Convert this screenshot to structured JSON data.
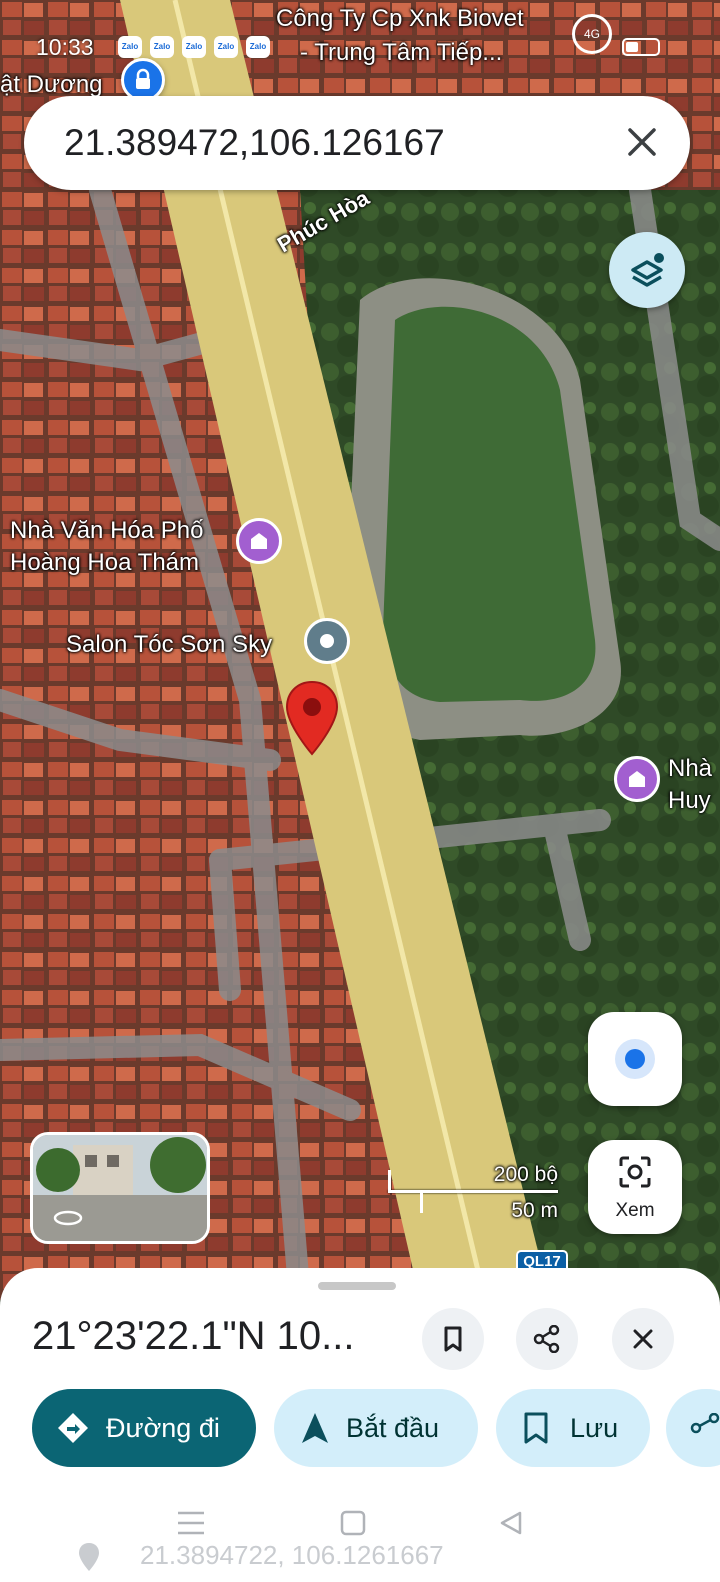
{
  "status_bar": {
    "time": "10:33",
    "zalo_label": "Zalo",
    "network": "4G"
  },
  "search": {
    "value": "21.389472,106.126167"
  },
  "map_labels": {
    "company": "Công Ty Cp Xnk Biovet",
    "company_line2": "- Trung Tâm Tiếp...",
    "street_top_left": "ật Dương",
    "road": "Phúc Hòa",
    "culture_house_line1": "Nhà Văn Hóa Phố",
    "culture_house_line2": "Hoàng Hoa Thám",
    "salon": "Salon Tóc Sơn Sky",
    "right_poi_line1": "Nhà",
    "right_poi_line2": "Huy",
    "road_shield": "QL17"
  },
  "scale": {
    "feet": "200 bộ",
    "meters": "50 m"
  },
  "lens_button": {
    "label": "Xem"
  },
  "sheet": {
    "title": "21°23'22.1\"N 10..."
  },
  "actions": [
    {
      "label": "Đường đi"
    },
    {
      "label": "Bắt đầu"
    },
    {
      "label": "Lưu"
    }
  ],
  "ghost_text": "21.3894722, 106.1261667",
  "colors": {
    "directions": "#0b6574",
    "pill": "#d3eefa",
    "pin": "#e22a22",
    "poi_purple": "#a25fd0"
  }
}
